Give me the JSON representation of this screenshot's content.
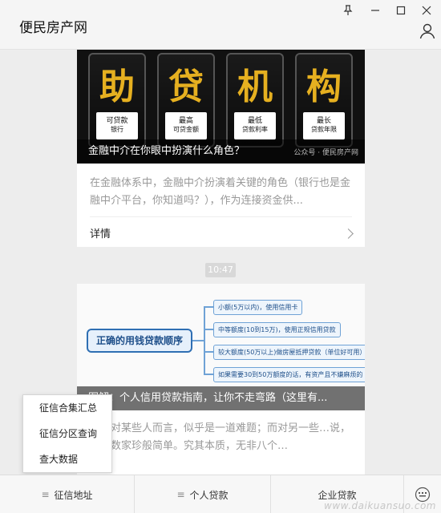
{
  "window": {
    "title": "便民房产网"
  },
  "feed": {
    "article1": {
      "tiles": [
        {
          "char": "助",
          "line1": "可贷款",
          "line2": "银行"
        },
        {
          "char": "贷",
          "line1": "最高",
          "line2": "可贷金额"
        },
        {
          "char": "机",
          "line1": "最低",
          "line2": "贷款利率"
        },
        {
          "char": "构",
          "line1": "最长",
          "line2": "贷款年限"
        }
      ],
      "caption": "金融中介在你眼中扮演什么角色？",
      "watermark": "公众号 · 便民房产网",
      "excerpt": "在金融体系中，金融中介扮演着关键的角色（银行也是金融中介平台，你知道吗？），作为连接资金供...",
      "detail_label": "详情"
    },
    "time": "10:47",
    "article2": {
      "root": "正确的用钱贷款顺序",
      "nodes": [
        "小额(5万以内)，使用信用卡",
        "中等额度(10到15万)，使用正规信用贷款",
        "较大额度(50万以上)做房屋抵押贷款（单位好可用）",
        "如果需要30到50万额度的话，有资产且不嫌麻烦的"
      ],
      "caption": "图解：个人信用贷款指南，让你不走弯路（这里有...",
      "excerpt": "…，对某些人而言，似乎是一道难题；而对另一些…说，却如数家珍般简单。究其本质，无非八个…"
    }
  },
  "popup_menu": {
    "items": [
      "征信合集汇总",
      "征信分区查询",
      "查大数据"
    ]
  },
  "bottom_menu": {
    "tabs": [
      "征信地址",
      "个人贷款",
      "企业贷款"
    ]
  },
  "site_watermark": "www.daikuansuo.com"
}
